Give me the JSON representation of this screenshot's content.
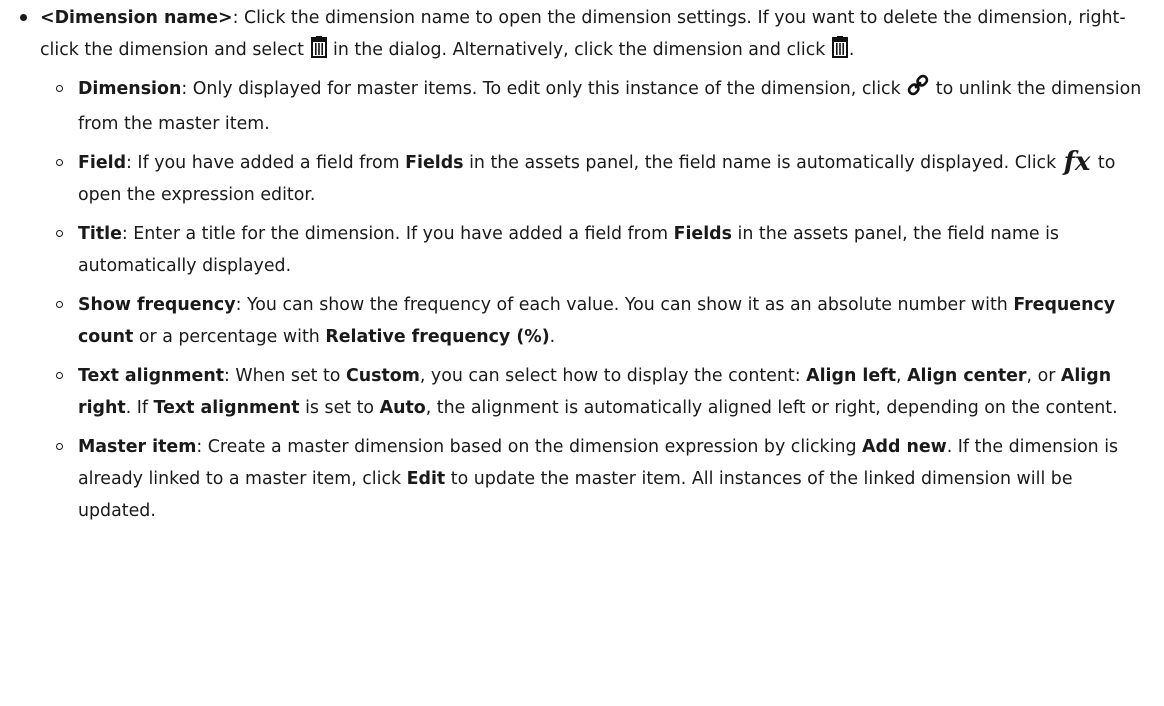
{
  "top": {
    "term": "<Dimension name>",
    "p1": ": Click the dimension name to open the dimension settings. If you want to delete the dimension, right-click the dimension and select ",
    "p2": " in the dialog. Alternatively, click the dimension and click ",
    "p3": "."
  },
  "fx_symbol": "fx",
  "icons": [
    "delete-icon",
    "unlink-icon",
    "fx-icon"
  ],
  "items": {
    "dimension": {
      "term": "Dimension",
      "p1": ": Only displayed for master items. To edit only this instance of the dimension, click ",
      "p2": " to unlink the dimension from the master item."
    },
    "field": {
      "term": "Field",
      "p1": ": If you have added a field from ",
      "b1": "Fields",
      "p2": " in the assets panel, the field name is automatically displayed. Click ",
      "p3": " to open the expression editor."
    },
    "title": {
      "term": "Title",
      "p1": ": Enter a title for the dimension. If you have added a field from ",
      "b1": "Fields",
      "p2": " in the assets panel, the field name is automatically displayed."
    },
    "frequency": {
      "term": "Show frequency",
      "p1": ": You can show the frequency of each value. You can show it as an absolute number with ",
      "b1": "Frequency count",
      "p2": " or a percentage with ",
      "b2": "Relative frequency (%)",
      "p3": "."
    },
    "alignment": {
      "term": "Text alignment",
      "p1": ": When set to ",
      "b1": "Custom",
      "p2": ", you can select how to display the content: ",
      "b2": "Align left",
      "p3": ", ",
      "b3": "Align center",
      "p4": ", or ",
      "b4": "Align right",
      "p5": ". If ",
      "b5": "Text alignment",
      "p6": " is set to ",
      "b6": "Auto",
      "p7": ", the alignment is automatically aligned left or right, depending on the content."
    },
    "master": {
      "term": "Master item",
      "p1": ":  Create a master dimension based on the dimension expression by clicking ",
      "b1": "Add new",
      "p2": ". If the dimension is already linked to a master item, click ",
      "b2": "Edit",
      "p3": " to update the master item. All instances of the linked dimension will be updated."
    }
  }
}
